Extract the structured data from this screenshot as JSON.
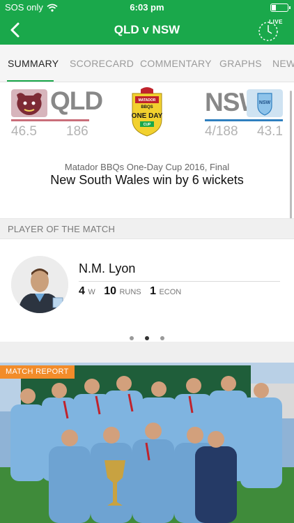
{
  "status_bar": {
    "carrier": "SOS only",
    "time": "6:03 pm"
  },
  "nav": {
    "title": "QLD v NSW",
    "live_label": "LIVE"
  },
  "tabs": [
    {
      "label": "SUMMARY",
      "active": true
    },
    {
      "label": "SCORECARD",
      "active": false
    },
    {
      "label": "COMMENTARY",
      "active": false
    },
    {
      "label": "GRAPHS",
      "active": false
    },
    {
      "label": "NEWS",
      "active": false
    }
  ],
  "home_team": {
    "code": "QLD",
    "stat_left": "46.5",
    "stat_right": "186",
    "color": "#b0303a"
  },
  "away_team": {
    "code": "NSW",
    "stat_left": "4/188",
    "stat_right": "43.1",
    "color": "#2f7fbf"
  },
  "competition_logo": {
    "top": "MATADOR",
    "middle": "BBQS",
    "main": "ONE DAY",
    "bottom": "CUP"
  },
  "result": {
    "competition": "Matador BBQs One-Day Cup 2016, Final",
    "text": "New South Wales win by 6 wickets"
  },
  "potm": {
    "header": "PLAYER OF THE MATCH",
    "name": "N.M. Lyon",
    "stats": [
      {
        "value": "4",
        "unit": "W"
      },
      {
        "value": "10",
        "unit": "RUNS"
      },
      {
        "value": "1",
        "unit": "ECON"
      }
    ]
  },
  "carousel": {
    "count": 3,
    "active_index": 1
  },
  "report": {
    "badge": "MATCH REPORT"
  },
  "colors": {
    "brand_green": "#1aa84b",
    "report_orange": "#f28c2a"
  }
}
